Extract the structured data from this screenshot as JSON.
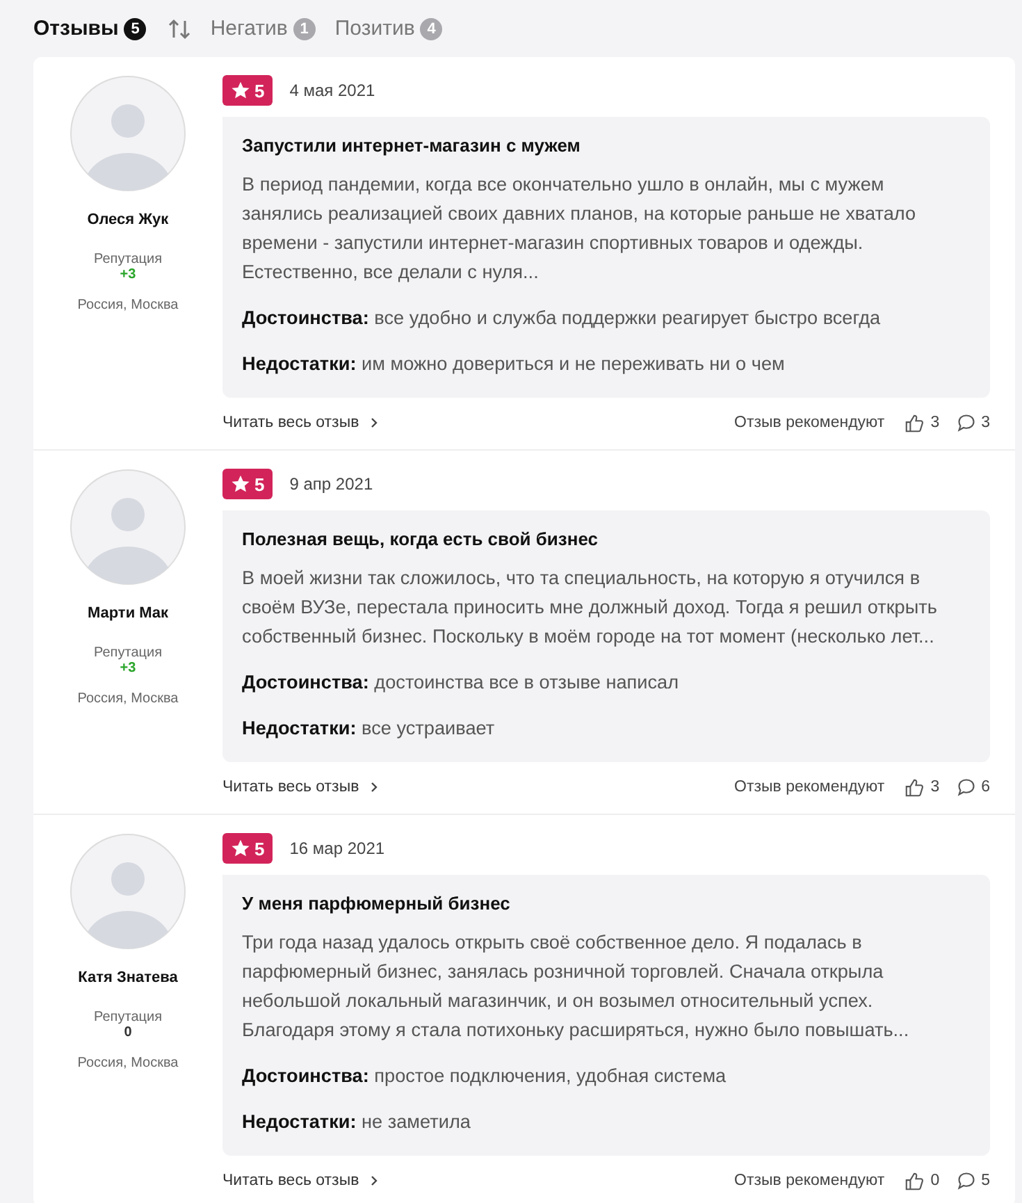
{
  "tabs": [
    {
      "label": "Отзывы",
      "count": "5",
      "selected": true
    },
    {
      "label": "Негатив",
      "count": "1",
      "selected": false
    },
    {
      "label": "Позитив",
      "count": "4",
      "selected": false
    }
  ],
  "reviews": [
    {
      "author": "Олеся Жук",
      "reputation_label": "Репутация",
      "reputation": "+3",
      "color": "#2aa52a",
      "location": "Россия, Москва",
      "rating": "5",
      "date": "4 мая 2021",
      "title": "Запустили интернет-магазин с мужем",
      "text": "В период пандемии, когда все окончательно ушло в онлайн, мы с мужем занялись реализацией своих давних планов, на которые раньше не хватало времени - запустили интернет-магазин спортивных товаров и одежды. Естественно, все делали с нуля...",
      "pros_label": "Достоинства:",
      "pros": "все удобно и служба поддержки реагирует быстро всегда",
      "cons_label": "Недостатки:",
      "cons": "им можно довериться и не переживать ни о чем",
      "read_more": "Читать весь отзыв",
      "recommend_label": "Отзыв рекомендуют",
      "likes": "3",
      "comments": "3"
    },
    {
      "author": "Марти Мак",
      "reputation_label": "Репутация",
      "reputation": "+3",
      "color": "#2aa52a",
      "location": "Россия, Москва",
      "rating": "5",
      "date": "9 апр 2021",
      "title": "Полезная вещь, когда есть свой бизнес",
      "text": "В моей жизни так сложилось, что та специальность, на которую я отучился в своём ВУЗе, перестала приносить мне должный доход. Тогда я решил открыть собственный бизнес. Поскольку в моём городе на тот момент (несколько лет...",
      "pros_label": "Достоинства:",
      "pros": "достоинства все в отзыве написал",
      "cons_label": "Недостатки:",
      "cons": "все устраивает",
      "read_more": "Читать весь отзыв",
      "recommend_label": "Отзыв рекомендуют",
      "likes": "3",
      "comments": "6"
    },
    {
      "author": "Катя Знатева",
      "reputation_label": "Репутация",
      "reputation": "0",
      "color": "#333333",
      "location": "Россия, Москва",
      "rating": "5",
      "date": "16 мар 2021",
      "title": "У меня парфюмерный бизнес",
      "text": "Три года назад удалось открыть своё собственное дело. Я подалась в парфюмерный бизнес, занялась розничной торговлей. Сначала открыла небольшой локальный магазинчик, и он возымел относительный успех. Благодаря этому я стала потихоньку расширяться, нужно было повышать...",
      "pros_label": "Достоинства:",
      "pros": "простое подключения, удобная система",
      "cons_label": "Недостатки:",
      "cons": "не заметила",
      "read_more": "Читать весь отзыв",
      "recommend_label": "Отзыв рекомендуют",
      "likes": "0",
      "comments": "5"
    }
  ]
}
